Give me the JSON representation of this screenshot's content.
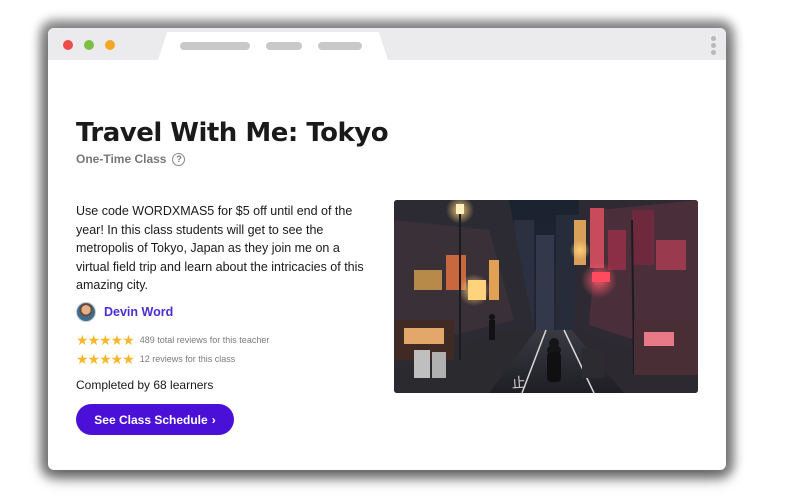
{
  "class": {
    "title": "Travel With Me: Tokyo",
    "type_label": "One-Time Class",
    "help_glyph": "?",
    "description": "Use code WORDXMAS5 for $5 off until end of the year! In this class students will get to see the metropolis of Tokyo, Japan as they join me on a virtual field trip and learn about the intricacies of this amazing city.",
    "teacher_name": "Devin Word",
    "teacher_reviews": "489 total reviews for this teacher",
    "class_reviews": "12 reviews for this class",
    "completed": "Completed by 68 learners",
    "cta_label": "See Class Schedule",
    "cta_glyph": "›",
    "stars": "★★★★★",
    "teacher_rating": 5,
    "class_rating": 5
  },
  "colors": {
    "accent": "#4a10d8",
    "teacher_link": "#4b2ed3",
    "star": "#f6b72d"
  },
  "icons": {
    "help": "help-icon",
    "chevron": "chevron-right-icon"
  }
}
